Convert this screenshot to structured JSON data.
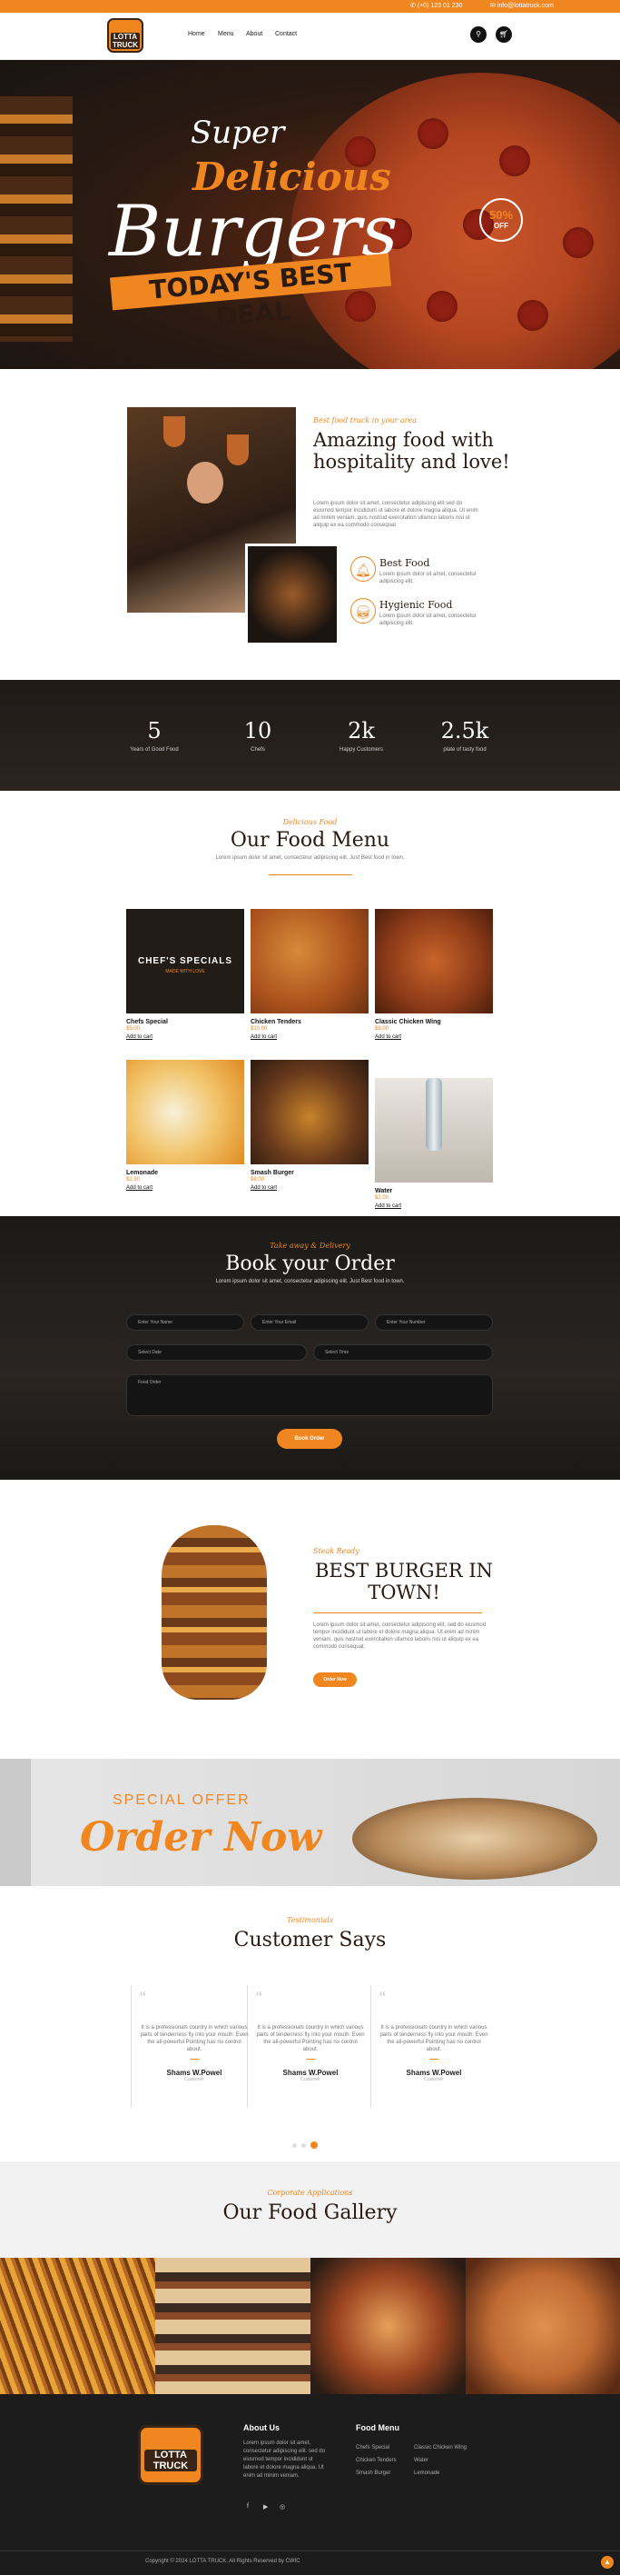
{
  "topbar": {
    "phone": "(+0) 123 01 230",
    "email": "info@lottatruck.com"
  },
  "brand": {
    "logo_text": "LOTTA TRUCK",
    "accent": "#f0861f",
    "dark": "#2a1a12"
  },
  "nav": {
    "items": [
      "Home",
      "Menu",
      "About",
      "Contact"
    ]
  },
  "hero": {
    "line1": "Super",
    "line2": "Delicious",
    "line3": "Burgers",
    "banner": "TODAY'S BEST DEAL",
    "badge_pct": "50%",
    "badge_off": "OFF"
  },
  "about": {
    "script": "Best food truck in your area",
    "title": "Amazing food with hospitality and love!",
    "body": "Lorem ipsum dolor sit amet, consectetur adipiscing elit sed do eiusmod tempor incididunt ut labore et dolore magna aliqua. Ut enim ad minim veniam, quis nostrud exercitation ullamco laboris nisi ut aliquip ex ea commodo consequat",
    "features": [
      {
        "icon": "bell-icon",
        "title": "Best Food",
        "desc": "Lorem ipsum dolor sit amet, consectetur adipiscing elit."
      },
      {
        "icon": "burger-icon",
        "title": "Hygienic Food",
        "desc": "Lorem ipsum dolor sit amet, consectetur adipiscing elit."
      }
    ]
  },
  "stats": [
    {
      "n": "5",
      "l": "Years of Good Food"
    },
    {
      "n": "10",
      "l": "Chefs"
    },
    {
      "n": "2k",
      "l": "Happy Customers"
    },
    {
      "n": "2.5k",
      "l": "plate of tasty food"
    }
  ],
  "menu": {
    "script": "Delicious Food",
    "title": "Our Food Menu",
    "sub": "Lorem ipsum dolor sit amet, consectetur adipiscing elit. Just Best food in town.",
    "add_label": "Add to cart",
    "items": [
      {
        "name": "Chefs Special",
        "price": "$5.00",
        "img": "#211c18",
        "overlay": "CHEF'S SPECIALS",
        "overlay_sub": "MADE WITH LOVE"
      },
      {
        "name": "Chicken Tenders",
        "price": "$10.00",
        "img": "#b86126"
      },
      {
        "name": "Classic Chicken Wing",
        "price": "$8.00",
        "img": "#a84a1d"
      },
      {
        "name": "Lemonade",
        "price": "$2.50",
        "img": "#f2c46a"
      },
      {
        "name": "Smash Burger",
        "price": "$8.00",
        "img": "#6a3a1c"
      },
      {
        "name": "Water",
        "price": "$2.00",
        "img": "#d9d4cc"
      }
    ]
  },
  "booking": {
    "script": "Take away & Delivery",
    "title": "Book your Order",
    "sub": "Lorem ipsum dolor sit amet, consectetur adipiscing elit. Just Best food in town.",
    "name_ph": "Enter Your Name",
    "email_ph": "Enter Your Email",
    "phone_ph": "Enter Your Number",
    "date_ph": "Select Date",
    "time_ph": "Select Time",
    "order_ph": "Food Order",
    "button": "Book Order"
  },
  "best": {
    "script": "Steak Ready",
    "title": "BEST BURGER IN TOWN!",
    "body": "Lorem ipsum dolor sit amet, consectetur adipiscing elit, sed do eiusmod tempor incididunt ut labore et dolore magna aliqua. Ut enim ad minim veniam, quis nostrud exercitation ullamco laboris nisi ut aliquip ex ea commodo consequat.",
    "button": "Order Now"
  },
  "offer": {
    "small": "SPECIAL OFFER",
    "big": "Order Now"
  },
  "testimonials": {
    "script": "Testimonials",
    "title": "Customer Says",
    "items": [
      {
        "quote": "It is a professionals country in which various parts of tenderness fly into your mouth. Even the all-powerful Pointing has no control about.",
        "name": "Shams W.Powel",
        "role": "Customer"
      },
      {
        "quote": "It is a professionals country in which various parts of tenderness fly into your mouth. Even the all-powerful Pointing has no control about.",
        "name": "Shams W.Powel",
        "role": "Customer"
      },
      {
        "quote": "It is a professionals country in which various parts of tenderness fly into your mouth. Even the all-powerful Pointing has no control about.",
        "name": "Shams W.Powel",
        "role": "Customer"
      }
    ]
  },
  "gallery": {
    "script": "Corporate Applications",
    "title": "Our Food Gallery",
    "images": [
      "#b76a24",
      "#3a2a20",
      "#9a4420",
      "#c06a32"
    ]
  },
  "footer": {
    "about_title": "About Us",
    "about_body": "Lorem ipsum dolor sit amet, consectetur adipiscing elit. sed do eiusmod tempor incididunt ut labore et dolore magna aliqua. Ut enim ad minim veniam.",
    "menu_title": "Food Menu",
    "menu_items": [
      "Chefs Special",
      "Chicken Tenders",
      "Smash Burger",
      "Classic Chicken Wing",
      "Water",
      "Lemonade"
    ],
    "copyright": "Copyright © 2024 LOTTA TRUCK. All Rights Reserved by CWIC"
  }
}
